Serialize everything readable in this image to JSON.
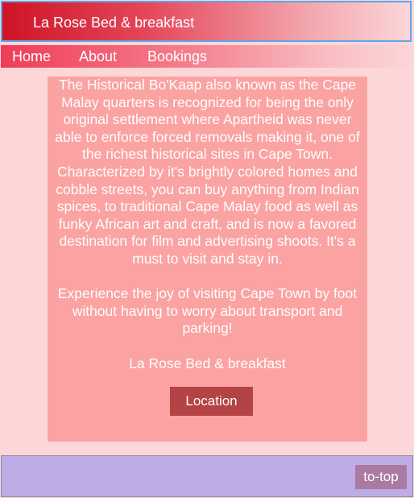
{
  "colors": {
    "page_background": "#fdd7d7",
    "header_accent": "#cf1425",
    "content_background": "#fba2a2",
    "location_button": "#b34345",
    "footer_background": "#beace7",
    "to_top_button": "#aa7aa3"
  },
  "header": {
    "site_title": "La Rose Bed & breakfast"
  },
  "nav": {
    "items": [
      {
        "label": "Home"
      },
      {
        "label": "About"
      },
      {
        "label": "Bookings"
      }
    ]
  },
  "main": {
    "paragraph_1": "The Historical Bo'Kaap also known as the Cape Malay quarters is recognized for being the only original settlement where Apartheid was never able to enforce forced removals making it, one of the richest historical sites in Cape Town. Characterized by it's brightly colored homes and cobble streets, you can buy anything from Indian spices, to traditional Cape Malay food as well as funky African art and craft, and is now a favored destination for film and advertising shoots. It's a must to visit and stay in.",
    "paragraph_2": "Experience the joy of visiting Cape Town by foot without having to worry about transport and parking!",
    "business_name": "La Rose Bed & breakfast",
    "location_button": "Location"
  },
  "footer": {
    "to_top_button": "to-top"
  }
}
